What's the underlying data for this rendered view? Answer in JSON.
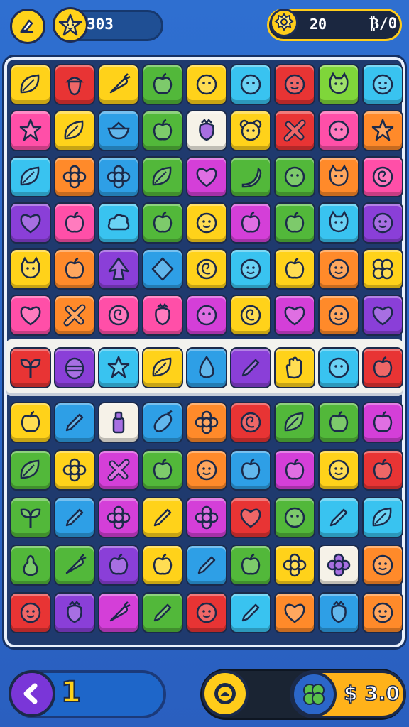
{
  "header": {
    "stars": "303",
    "right_value": "20",
    "right_symbol": "₿/0"
  },
  "footer": {
    "level": "1",
    "boost_value": "$ 3.0"
  },
  "colors": {
    "background": "#2a66c7",
    "accent_yellow": "#ffd21a",
    "board_frame": "#1f3a6e",
    "tile_palette": {
      "y": "#ffd21a",
      "r": "#e83434",
      "g": "#52b83a",
      "b": "#2e9fe6",
      "p": "#ff4fa8",
      "o": "#ff8a2a",
      "v": "#8a3fd8",
      "m": "#d43fd8",
      "l": "#7fd63a",
      "w": "#f6f2e8",
      "c": "#39c3f0"
    }
  },
  "board": {
    "rows": [
      [
        "y:leaf",
        "r:acorn",
        "y:carrot",
        "g:apple",
        "y:blob",
        "c:blob",
        "r:face",
        "l:cat",
        "c:face"
      ],
      [
        "p:star",
        "y:leaf",
        "b:bowl",
        "g:apple",
        "w:berry",
        "y:bear",
        "r:cross",
        "p:blob",
        "o:star"
      ],
      [
        "c:leaf",
        "o:flower",
        "b:flower",
        "g:leaf",
        "m:heart",
        "g:banana",
        "g:blob",
        "o:cat",
        "p:swirl"
      ],
      [
        "v:heart",
        "p:apple",
        "c:cloud",
        "g:apple",
        "y:face",
        "m:apple",
        "g:apple",
        "c:cat",
        "v:face"
      ],
      [
        "y:cat",
        "o:apple",
        "v:arrow",
        "b:diamond",
        "y:swirl",
        "c:face",
        "y:apple",
        "o:face",
        "y:clover"
      ],
      [
        "p:heart",
        "o:cross",
        "p:swirl",
        "p:berry",
        "m:blob",
        "y:swirl",
        "m:heart",
        "o:face",
        "v:heart"
      ]
    ],
    "divider_row": [
      "r:sprout",
      "v:egg",
      "c:star",
      "y:leaf",
      "b:drop",
      "v:pencil",
      "y:hand",
      "c:blob",
      "r:apple"
    ],
    "lower_rows": [
      [
        "y:apple",
        "b:pencil",
        "w:bottle",
        "b:eggplant",
        "o:flower",
        "r:swirl",
        "g:leaf",
        "g:apple",
        "m:apple"
      ],
      [
        "g:leaf",
        "y:flower",
        "m:cross",
        "g:apple",
        "o:face",
        "b:apple",
        "m:apple",
        "y:face",
        "r:apple"
      ],
      [
        "g:sprout",
        "b:pencil",
        "m:flower",
        "y:pencil",
        "m:flower",
        "r:heart",
        "g:blob",
        "c:pencil",
        "c:leaf"
      ],
      [
        "g:pear",
        "g:carrot",
        "v:apple",
        "y:apple",
        "b:pencil",
        "g:apple",
        "y:flower",
        "w:flower",
        "o:face"
      ],
      [
        "r:face",
        "v:berry",
        "m:carrot",
        "g:pencil",
        "r:face",
        "c:pencil",
        "o:heart",
        "b:berry",
        "o:face"
      ]
    ]
  }
}
